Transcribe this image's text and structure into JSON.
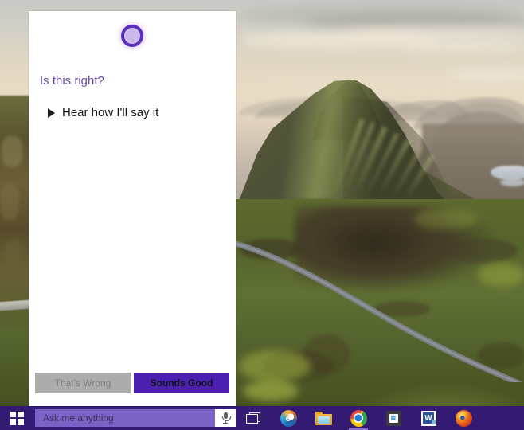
{
  "desktop": {
    "wallpaper_name": "quiraing-isle-of-skye-wallpaper",
    "wallpaper_alt": "Green mountain ridge at sunrise with winding road"
  },
  "cortana_panel": {
    "logo_icon": "cortana-ring-icon",
    "heading": "Is this right?",
    "play_icon": "play-triangle-icon",
    "hear_label": "Hear how I'll say it",
    "buttons": {
      "reject_label": "That's Wrong",
      "confirm_label": "Sounds Good"
    },
    "colors": {
      "heading": "#6a4aa6",
      "confirm_bg": "#4b20b0",
      "reject_bg": "#abacab",
      "ring": "#5b2fc0",
      "panel_bg": "#ffffff"
    }
  },
  "taskbar": {
    "color": "#331b73",
    "start": {
      "label": "Start",
      "icon": "windows-logo-icon"
    },
    "search": {
      "placeholder": "Ask me anything",
      "value": "",
      "mic_icon": "microphone-icon"
    },
    "items": [
      {
        "label": "Task View",
        "icon": "task-view-icon"
      },
      {
        "label": "Microsoft Edge",
        "icon": "edge-icon",
        "glyph": "e"
      },
      {
        "label": "File Explorer",
        "icon": "file-explorer-icon"
      },
      {
        "label": "Google Chrome",
        "icon": "chrome-icon"
      },
      {
        "label": "Store",
        "icon": "store-icon"
      },
      {
        "label": "Word",
        "icon": "word-icon",
        "glyph": "W"
      },
      {
        "label": "Mozilla Firefox",
        "icon": "firefox-icon"
      }
    ]
  }
}
